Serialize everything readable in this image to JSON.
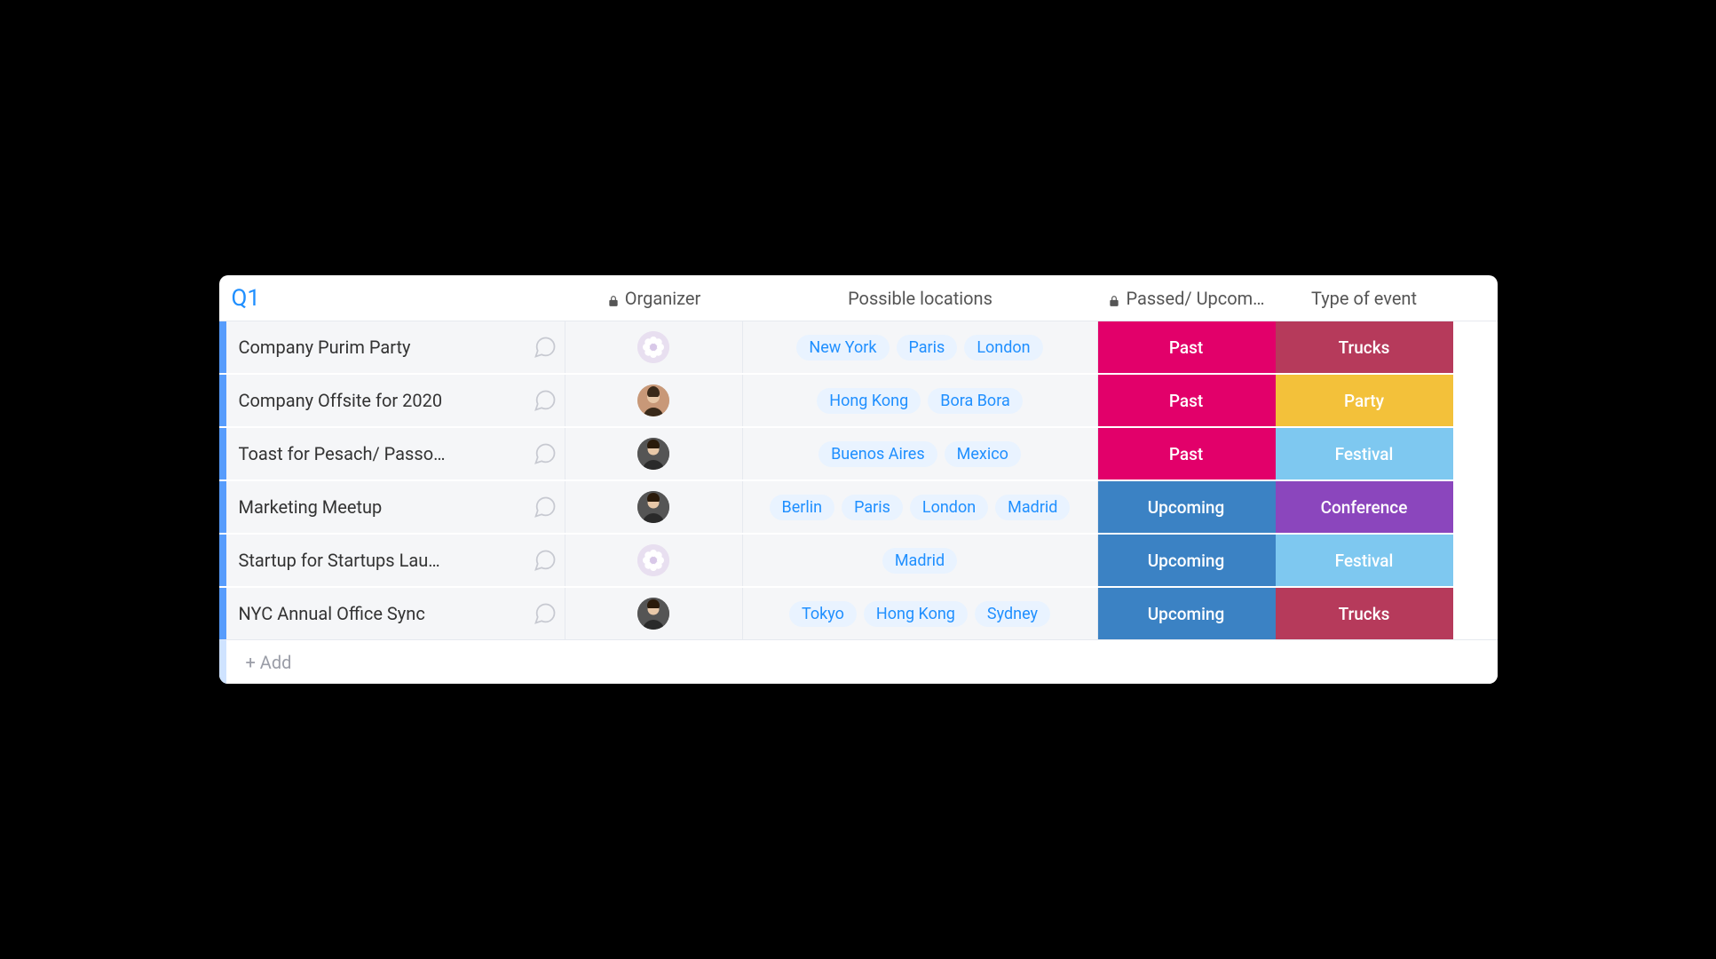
{
  "group_title": "Q1",
  "add_label": "+ Add",
  "columns": {
    "organizer": "Organizer",
    "locations": "Possible locations",
    "status": "Passed/ Upcom…",
    "type": "Type of event"
  },
  "colors": {
    "pink": "#e2006a",
    "blue": "#3b82c4",
    "maroon": "#b63a5b",
    "yellow": "#f3c13a",
    "sky": "#7ec8f0",
    "purple": "#8b46bd"
  },
  "rows": [
    {
      "name": "Company Purim Party",
      "organizer": "flower",
      "locations": [
        "New York",
        "Paris",
        "London"
      ],
      "status": {
        "label": "Past",
        "color_key": "pink"
      },
      "type": {
        "label": "Trucks",
        "color_key": "maroon"
      }
    },
    {
      "name": "Company Offsite for 2020",
      "organizer": "person",
      "locations": [
        "Hong Kong",
        "Bora Bora"
      ],
      "status": {
        "label": "Past",
        "color_key": "pink"
      },
      "type": {
        "label": "Party",
        "color_key": "yellow"
      }
    },
    {
      "name": "Toast for Pesach/ Passo…",
      "organizer": "person2",
      "locations": [
        "Buenos Aires",
        "Mexico"
      ],
      "status": {
        "label": "Past",
        "color_key": "pink"
      },
      "type": {
        "label": "Festival",
        "color_key": "sky"
      }
    },
    {
      "name": "Marketing Meetup",
      "organizer": "person2",
      "locations": [
        "Berlin",
        "Paris",
        "London",
        "Madrid"
      ],
      "status": {
        "label": "Upcoming",
        "color_key": "blue"
      },
      "type": {
        "label": "Conference",
        "color_key": "purple"
      }
    },
    {
      "name": "Startup for Startups Lau…",
      "organizer": "flower",
      "locations": [
        "Madrid"
      ],
      "status": {
        "label": "Upcoming",
        "color_key": "blue"
      },
      "type": {
        "label": "Festival",
        "color_key": "sky"
      }
    },
    {
      "name": "NYC Annual Office Sync",
      "organizer": "person2",
      "locations": [
        "Tokyo",
        "Hong Kong",
        "Sydney"
      ],
      "status": {
        "label": "Upcoming",
        "color_key": "blue"
      },
      "type": {
        "label": "Trucks",
        "color_key": "maroon"
      }
    }
  ]
}
